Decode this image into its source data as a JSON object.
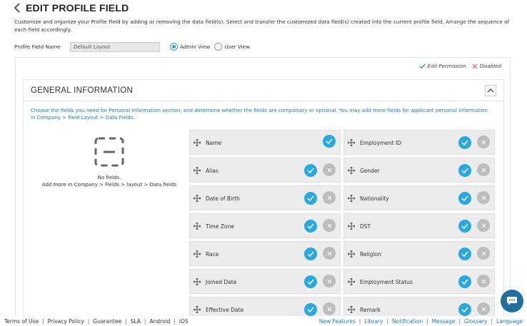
{
  "page": {
    "title": "EDIT PROFILE FIELD",
    "description": "Customize and organize your Profile Field by adding or removing the data field(s). Select and transfer the customized data field(s) created into the current profile field. Arrange the sequence of each field accordingly."
  },
  "profile_field": {
    "label": "Profile Field Name",
    "value": "Default Layout",
    "view_options": [
      {
        "label": "Admin View",
        "selected": true
      },
      {
        "label": "User View",
        "selected": false
      }
    ]
  },
  "legend": {
    "edit_permission": "Edit Permission",
    "disabled": "Disabled"
  },
  "section": {
    "title": "GENERAL INFORMATION",
    "description": "Choose the fields you need for Personal Information section, and determine whether the fields are compulsory or optional. You may add more fields for applicant personal information in Company > Field Layout > Data Fields.",
    "no_fields_title": "No fields.",
    "no_fields_hint": "Add more in Company > Fields > layout > Data fields"
  },
  "fields": [
    {
      "label": "Name",
      "removable": false
    },
    {
      "label": "Employment ID",
      "removable": true
    },
    {
      "label": "Alias",
      "removable": true
    },
    {
      "label": "Gender",
      "removable": true
    },
    {
      "label": "Date of Birth",
      "removable": true
    },
    {
      "label": "Nationality",
      "removable": true
    },
    {
      "label": "Time Zone",
      "removable": true
    },
    {
      "label": "DST",
      "removable": true
    },
    {
      "label": "Race",
      "removable": true
    },
    {
      "label": "Religion",
      "removable": true
    },
    {
      "label": "Joined Date",
      "removable": true
    },
    {
      "label": "Employment Status",
      "removable": true
    },
    {
      "label": "Effective Date",
      "removable": true
    },
    {
      "label": "Remark",
      "removable": true
    }
  ],
  "footer": {
    "left": [
      "Terms of Use",
      "Privacy Policy",
      "Guarantee",
      "SLA",
      "Android",
      "iOS"
    ],
    "right": [
      "New Features",
      "Library",
      "Notification",
      "Message",
      "Glossary",
      "Language"
    ]
  },
  "colors": {
    "accent": "#2aa8e0",
    "link": "#1e7bbf",
    "disabled": "#bdbdbd"
  }
}
